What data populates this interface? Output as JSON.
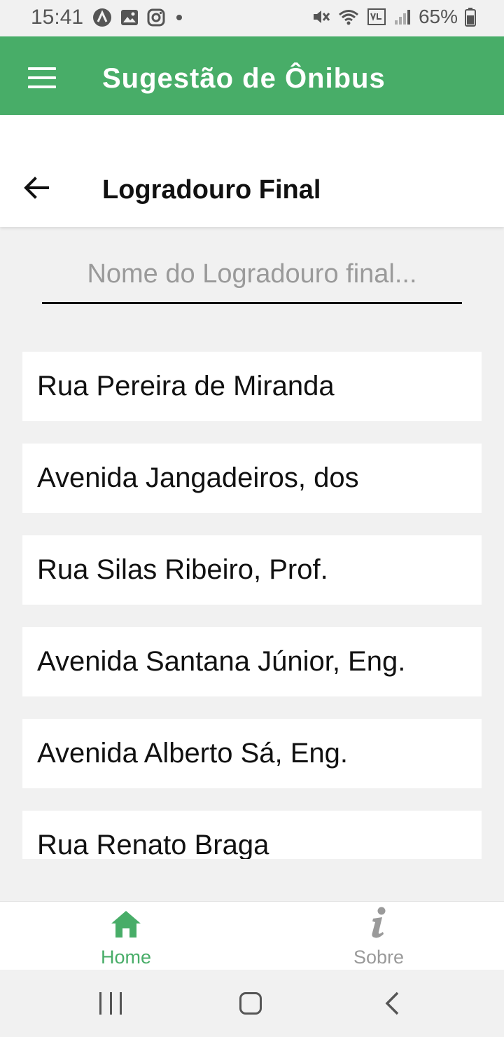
{
  "status_bar": {
    "time": "15:41",
    "battery": "65%"
  },
  "app_bar": {
    "title": "Sugestão de Ônibus"
  },
  "sub_header": {
    "title": "Logradouro Final"
  },
  "search": {
    "placeholder": "Nome do Logradouro final...",
    "value": ""
  },
  "streets": [
    "Rua Pereira de Miranda",
    "Avenida Jangadeiros, dos",
    "Rua Silas Ribeiro, Prof.",
    "Avenida Santana Júnior, Eng.",
    "Avenida Alberto Sá, Eng.",
    "Rua Renato Braga"
  ],
  "bottom_nav": {
    "items": [
      {
        "label": "Home",
        "icon": "home-icon",
        "active": true
      },
      {
        "label": "Sobre",
        "icon": "info-icon",
        "active": false
      }
    ]
  },
  "colors": {
    "primary": "#48ad68",
    "inactive": "#9a9a9a"
  }
}
